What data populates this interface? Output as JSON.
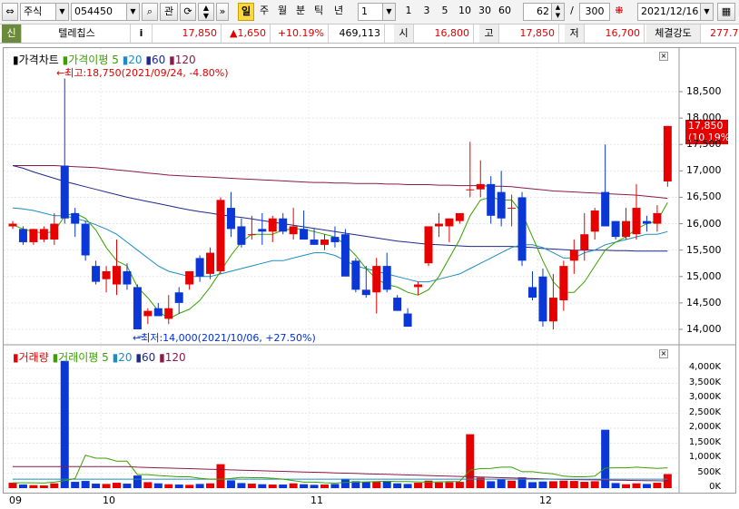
{
  "toolbar": {
    "market_type": "주식",
    "stock_code": "054450",
    "btn_gwan": "관",
    "periods": [
      "일",
      "주",
      "월",
      "분",
      "틱",
      "년"
    ],
    "selected_period": "일",
    "interval_value": "1",
    "quick_intervals": [
      "1",
      "3",
      "5",
      "10",
      "30",
      "60"
    ],
    "count_value": "62",
    "count_sep": "/",
    "count_max": "300",
    "date_value": "2021/12/16"
  },
  "quote": {
    "flag": "신",
    "name": "텔레칩스",
    "info": "i",
    "price": "17,850",
    "change": "▲1,650",
    "change_pct": "+10.19%",
    "volume": "469,113",
    "open_label": "시",
    "open": "16,800",
    "high_label": "고",
    "high": "17,850",
    "low_label": "저",
    "low": "16,700",
    "strength_label": "체결강도",
    "strength": "277.7"
  },
  "price_panel": {
    "legend": {
      "title": "가격차트",
      "ma_title": "가격이평",
      "ma": [
        "5",
        "20",
        "60",
        "120"
      ]
    },
    "high_annot": "←최고:18,750(2021/09/24, -4.80%)",
    "low_annot": "←최저:14,000(2021/10/06, +27.50%)",
    "current_box": [
      "17,850",
      "(10.19%)"
    ],
    "y_ticks": [
      "18,500",
      "18,000",
      "17,500",
      "17,000",
      "16,500",
      "16,000",
      "15,500",
      "15,000",
      "14,500",
      "14,000"
    ]
  },
  "volume_panel": {
    "legend": {
      "title": "거래량",
      "ma_title": "거래이평",
      "ma": [
        "5",
        "20",
        "60",
        "120"
      ]
    },
    "y_ticks": [
      "4,000K",
      "3,500K",
      "3,000K",
      "2,500K",
      "2,000K",
      "1,500K",
      "1,000K",
      "500K",
      "0K"
    ]
  },
  "x_labels": [
    "09",
    "10",
    "11",
    "12"
  ],
  "colors": {
    "up": "#e60000",
    "down": "#0a37d6",
    "ma5": "#3aa000",
    "ma20": "#1b8cc4",
    "ma60": "#1d2a8a",
    "ma120": "#8b1a4a"
  },
  "chart_data": {
    "type": "candlestick",
    "price_range": [
      13950,
      18750
    ],
    "volume_range": [
      0,
      4300
    ],
    "candles": [
      {
        "o": 15950,
        "h": 16050,
        "l": 15900,
        "c": 16000
      },
      {
        "o": 15900,
        "h": 15950,
        "l": 15600,
        "c": 15650
      },
      {
        "o": 15650,
        "h": 15900,
        "l": 15600,
        "c": 15900
      },
      {
        "o": 15700,
        "h": 15950,
        "l": 15650,
        "c": 15900
      },
      {
        "o": 15700,
        "h": 16200,
        "l": 15600,
        "c": 16000
      },
      {
        "o": 17100,
        "h": 18750,
        "l": 16000,
        "c": 16100
      },
      {
        "o": 16200,
        "h": 16300,
        "l": 15750,
        "c": 16000
      },
      {
        "o": 16000,
        "h": 16050,
        "l": 15300,
        "c": 15400
      },
      {
        "o": 15200,
        "h": 15300,
        "l": 14850,
        "c": 14900
      },
      {
        "o": 14950,
        "h": 15200,
        "l": 14700,
        "c": 15100
      },
      {
        "o": 14850,
        "h": 15700,
        "l": 14650,
        "c": 15200
      },
      {
        "o": 15100,
        "h": 15250,
        "l": 14750,
        "c": 14850
      },
      {
        "o": 14800,
        "h": 14850,
        "l": 14000,
        "c": 14000
      },
      {
        "o": 14250,
        "h": 14400,
        "l": 14100,
        "c": 14350
      },
      {
        "o": 14400,
        "h": 14500,
        "l": 14300,
        "c": 14250
      },
      {
        "o": 14200,
        "h": 14650,
        "l": 14100,
        "c": 14400
      },
      {
        "o": 14700,
        "h": 14800,
        "l": 14300,
        "c": 14500
      },
      {
        "o": 14850,
        "h": 15100,
        "l": 14750,
        "c": 15100
      },
      {
        "o": 15350,
        "h": 15400,
        "l": 14900,
        "c": 15000
      },
      {
        "o": 15050,
        "h": 15550,
        "l": 14950,
        "c": 15450
      },
      {
        "o": 15100,
        "h": 16500,
        "l": 15050,
        "c": 16450
      },
      {
        "o": 16300,
        "h": 16600,
        "l": 15750,
        "c": 15900
      },
      {
        "o": 15950,
        "h": 16100,
        "l": 15550,
        "c": 15600
      },
      {
        "o": 15800,
        "h": 16150,
        "l": 15700,
        "c": 15800
      },
      {
        "o": 15900,
        "h": 16200,
        "l": 15600,
        "c": 15850
      },
      {
        "o": 15850,
        "h": 16150,
        "l": 15650,
        "c": 16100
      },
      {
        "o": 16100,
        "h": 16200,
        "l": 15800,
        "c": 15850
      },
      {
        "o": 15800,
        "h": 16300,
        "l": 15700,
        "c": 15950
      },
      {
        "o": 15900,
        "h": 16250,
        "l": 15700,
        "c": 15700
      },
      {
        "o": 15700,
        "h": 15900,
        "l": 15600,
        "c": 15600
      },
      {
        "o": 15600,
        "h": 15800,
        "l": 15500,
        "c": 15700
      },
      {
        "o": 15750,
        "h": 15950,
        "l": 15550,
        "c": 15650
      },
      {
        "o": 15800,
        "h": 15900,
        "l": 15100,
        "c": 15000
      },
      {
        "o": 15300,
        "h": 15350,
        "l": 14700,
        "c": 14750
      },
      {
        "o": 14750,
        "h": 15200,
        "l": 14600,
        "c": 14650
      },
      {
        "o": 14700,
        "h": 15350,
        "l": 14300,
        "c": 15200
      },
      {
        "o": 15200,
        "h": 15450,
        "l": 14700,
        "c": 14750
      },
      {
        "o": 14600,
        "h": 14650,
        "l": 14350,
        "c": 14350
      },
      {
        "o": 14300,
        "h": 14400,
        "l": 14050,
        "c": 14050
      },
      {
        "o": 14800,
        "h": 14900,
        "l": 14650,
        "c": 14850
      },
      {
        "o": 15250,
        "h": 15400,
        "l": 15200,
        "c": 15950
      },
      {
        "o": 15950,
        "h": 16200,
        "l": 15750,
        "c": 16000
      },
      {
        "o": 15950,
        "h": 16050,
        "l": 15650,
        "c": 16100
      },
      {
        "o": 16050,
        "h": 16100,
        "l": 16000,
        "c": 16200
      },
      {
        "o": 16650,
        "h": 17550,
        "l": 16500,
        "c": 16650
      },
      {
        "o": 16650,
        "h": 17200,
        "l": 16500,
        "c": 16750
      },
      {
        "o": 16750,
        "h": 16900,
        "l": 16000,
        "c": 16150
      },
      {
        "o": 16600,
        "h": 17000,
        "l": 15950,
        "c": 16100
      },
      {
        "o": 16300,
        "h": 16550,
        "l": 15950,
        "c": 16300
      },
      {
        "o": 16500,
        "h": 16600,
        "l": 15200,
        "c": 15300
      },
      {
        "o": 14800,
        "h": 15100,
        "l": 14550,
        "c": 14600
      },
      {
        "o": 15000,
        "h": 15150,
        "l": 14050,
        "c": 14150
      },
      {
        "o": 14150,
        "h": 15050,
        "l": 14000,
        "c": 14600
      },
      {
        "o": 14550,
        "h": 15300,
        "l": 14350,
        "c": 15200
      },
      {
        "o": 15300,
        "h": 15700,
        "l": 15050,
        "c": 15500
      },
      {
        "o": 15500,
        "h": 16200,
        "l": 15300,
        "c": 15800
      },
      {
        "o": 15850,
        "h": 16300,
        "l": 15700,
        "c": 16250
      },
      {
        "o": 16600,
        "h": 17500,
        "l": 15950,
        "c": 15950
      },
      {
        "o": 16050,
        "h": 16050,
        "l": 15700,
        "c": 15750
      },
      {
        "o": 15750,
        "h": 16300,
        "l": 15700,
        "c": 16050
      },
      {
        "o": 15800,
        "h": 16750,
        "l": 15700,
        "c": 16300
      },
      {
        "o": 16050,
        "h": 16150,
        "l": 15850,
        "c": 16000
      },
      {
        "o": 16000,
        "h": 16350,
        "l": 15850,
        "c": 16200
      },
      {
        "o": 16800,
        "h": 17850,
        "l": 16700,
        "c": 17850
      }
    ],
    "volumes": [
      180,
      120,
      100,
      90,
      160,
      4250,
      210,
      240,
      150,
      140,
      180,
      150,
      420,
      200,
      160,
      130,
      120,
      110,
      140,
      160,
      800,
      260,
      170,
      150,
      130,
      120,
      120,
      160,
      130,
      110,
      120,
      140,
      310,
      230,
      200,
      210,
      220,
      160,
      140,
      180,
      250,
      190,
      200,
      210,
      1800,
      350,
      230,
      300,
      250,
      360,
      200,
      220,
      230,
      250,
      240,
      210,
      230,
      1950,
      170,
      130,
      160,
      140,
      180,
      470
    ],
    "ma": {
      "ma5": [
        15980,
        15900,
        15850,
        15820,
        15850,
        16150,
        16200,
        16100,
        15880,
        15550,
        15300,
        15200,
        14800,
        14600,
        14350,
        14200,
        14300,
        14380,
        14550,
        14800,
        15100,
        15400,
        15650,
        15800,
        15800,
        15800,
        15880,
        15900,
        15900,
        15850,
        15800,
        15750,
        15600,
        15400,
        15150,
        14950,
        14850,
        14800,
        14700,
        14650,
        14750,
        15000,
        15350,
        15700,
        16150,
        16450,
        16500,
        16450,
        16450,
        16200,
        15750,
        15300,
        14900,
        14700,
        14700,
        14900,
        15200,
        15500,
        15650,
        15750,
        15900,
        16000,
        16050,
        16400
      ],
      "ma20": [
        16300,
        16280,
        16250,
        16200,
        16150,
        16150,
        16100,
        16050,
        15980,
        15900,
        15800,
        15650,
        15500,
        15350,
        15200,
        15100,
        15050,
        15000,
        15000,
        15000,
        15050,
        15100,
        15150,
        15200,
        15250,
        15300,
        15300,
        15350,
        15400,
        15450,
        15450,
        15400,
        15300,
        15200,
        15150,
        15100,
        15050,
        15000,
        14950,
        14900,
        14900,
        14950,
        15000,
        15050,
        15150,
        15250,
        15350,
        15450,
        15550,
        15600,
        15600,
        15550,
        15450,
        15350,
        15350,
        15450,
        15500,
        15600,
        15650,
        15700,
        15750,
        15800,
        15800,
        15850
      ],
      "ma60": [
        17100,
        17050,
        16980,
        16920,
        16860,
        16800,
        16750,
        16700,
        16650,
        16600,
        16550,
        16500,
        16460,
        16420,
        16380,
        16340,
        16300,
        16260,
        16230,
        16200,
        16170,
        16140,
        16120,
        16090,
        16060,
        16030,
        16000,
        15970,
        15940,
        15910,
        15880,
        15850,
        15820,
        15790,
        15760,
        15730,
        15700,
        15670,
        15650,
        15630,
        15610,
        15600,
        15590,
        15580,
        15570,
        15570,
        15570,
        15570,
        15570,
        15560,
        15550,
        15530,
        15520,
        15510,
        15500,
        15500,
        15500,
        15500,
        15490,
        15490,
        15480,
        15480,
        15480,
        15480
      ],
      "ma120": [
        17100,
        17100,
        17100,
        17100,
        17100,
        17090,
        17080,
        17070,
        17060,
        17040,
        17020,
        17000,
        16980,
        16960,
        16940,
        16920,
        16910,
        16900,
        16890,
        16880,
        16870,
        16860,
        16850,
        16840,
        16830,
        16820,
        16810,
        16800,
        16790,
        16780,
        16780,
        16770,
        16770,
        16760,
        16760,
        16760,
        16750,
        16750,
        16740,
        16740,
        16740,
        16730,
        16730,
        16720,
        16720,
        16720,
        16710,
        16710,
        16700,
        16680,
        16660,
        16640,
        16620,
        16610,
        16600,
        16590,
        16580,
        16570,
        16560,
        16550,
        16540,
        16520,
        16500,
        16480
      ],
      "vma5": [
        180,
        180,
        180,
        170,
        200,
        250,
        320,
        1100,
        1000,
        1000,
        900,
        900,
        450,
        450,
        420,
        400,
        380,
        380,
        330,
        300,
        300,
        320,
        360,
        350,
        350,
        330,
        300,
        250,
        200,
        200,
        180,
        170,
        190,
        200,
        210,
        220,
        230,
        220,
        220,
        210,
        200,
        210,
        220,
        220,
        600,
        650,
        660,
        700,
        700,
        550,
        550,
        510,
        480,
        400,
        380,
        380,
        400,
        670,
        680,
        680,
        700,
        680,
        660,
        680
      ],
      "vma20": [
        300,
        300,
        300,
        300,
        300,
        300,
        300,
        300,
        300,
        300,
        300,
        300,
        300,
        300,
        300,
        300,
        300,
        300,
        300,
        300,
        300,
        300,
        300,
        300,
        300,
        300,
        300,
        300,
        300,
        300,
        300,
        300,
        300,
        300,
        300,
        300,
        300,
        300,
        300,
        300,
        300,
        300,
        300,
        300,
        300,
        300,
        300,
        300,
        300,
        300,
        300,
        300,
        300,
        300,
        300,
        300,
        300,
        300,
        300,
        300,
        300,
        300,
        300,
        300
      ],
      "vma120": [
        720,
        720,
        720,
        720,
        720,
        720,
        720,
        720,
        720,
        720,
        720,
        720,
        700,
        690,
        680,
        670,
        660,
        650,
        640,
        630,
        620,
        610,
        600,
        590,
        580,
        570,
        560,
        550,
        540,
        530,
        520,
        510,
        500,
        490,
        480,
        470,
        460,
        450,
        440,
        430,
        420,
        410,
        400,
        390,
        380,
        370,
        360,
        350,
        340,
        330,
        320,
        310,
        300,
        290,
        285,
        280,
        275,
        270,
        265,
        260,
        255,
        250,
        245,
        240
      ]
    }
  }
}
